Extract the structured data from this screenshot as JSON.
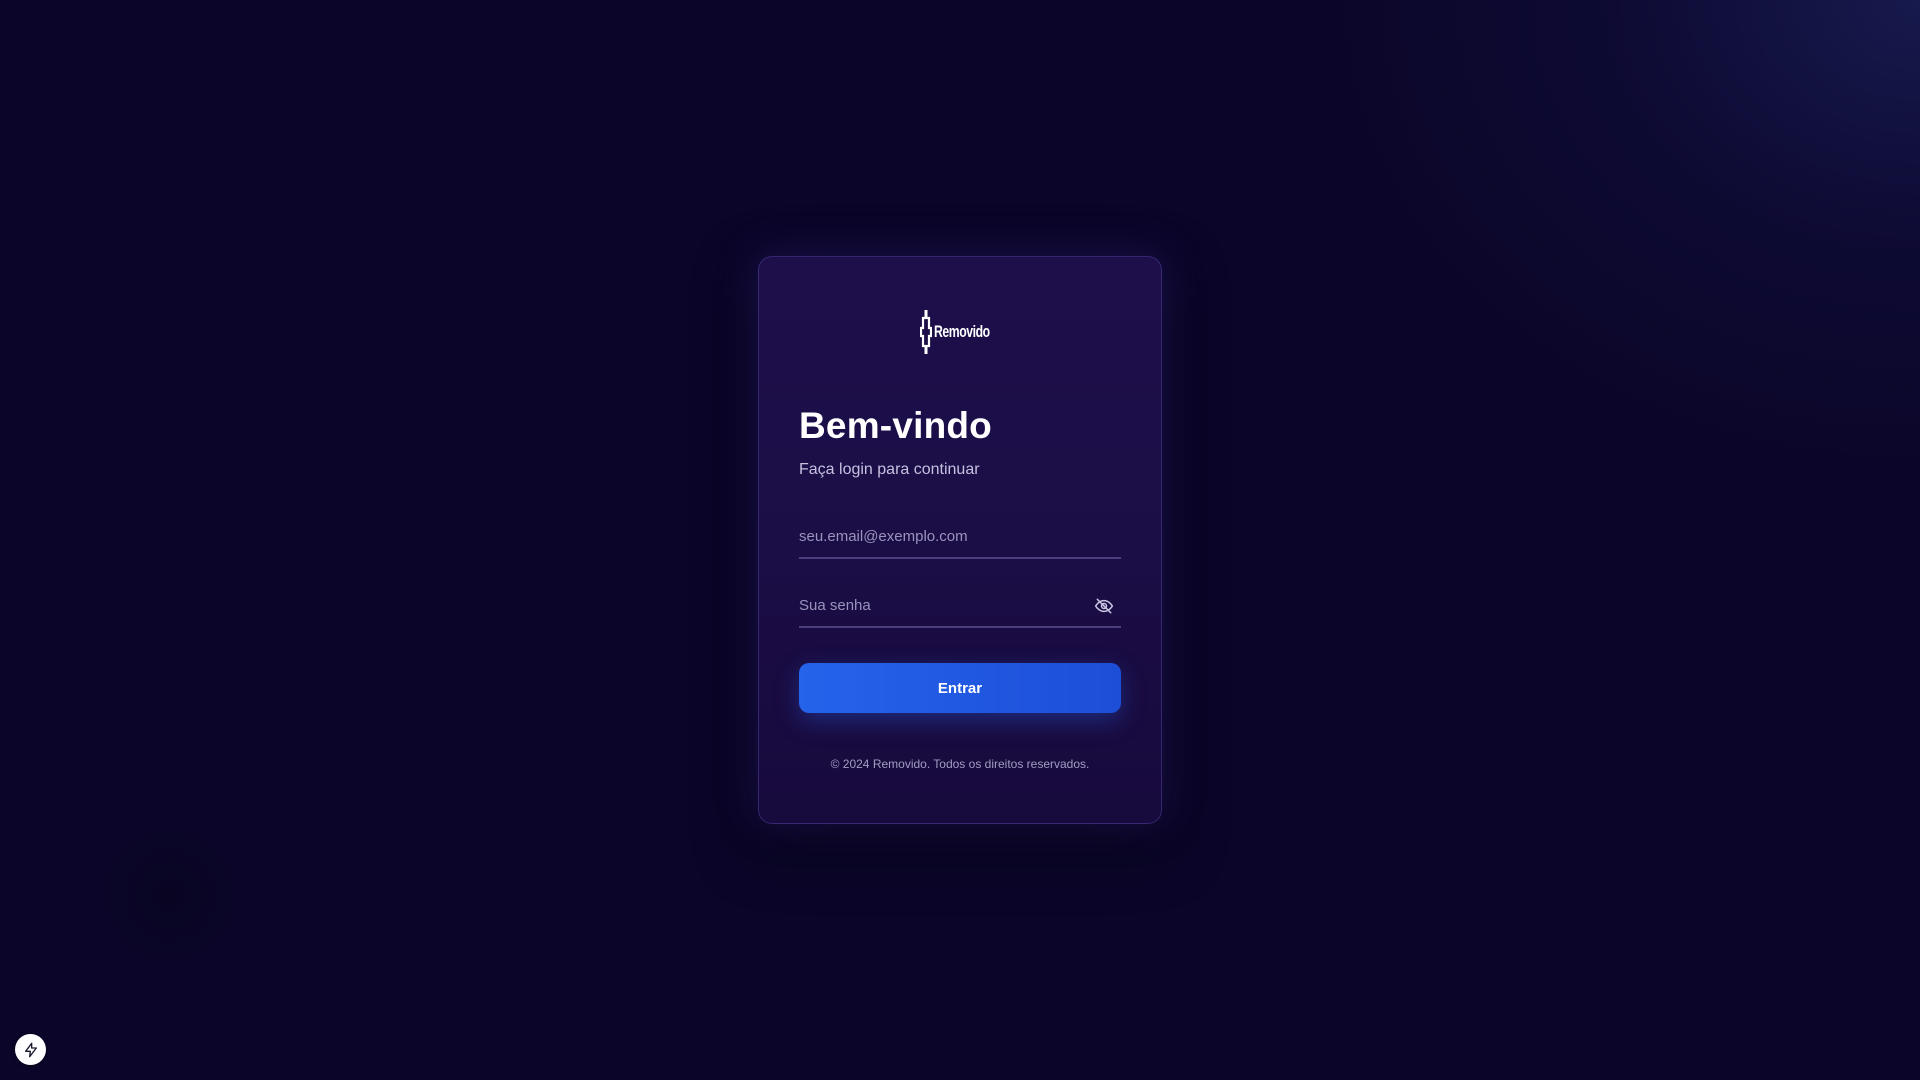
{
  "brand": {
    "logo_text": "Removido",
    "logo_icon": "bracket-logo-icon"
  },
  "login": {
    "title": "Bem-vindo",
    "subtitle": "Faça login para continuar",
    "email_placeholder": "seu.email@exemplo.com",
    "email_value": "",
    "password_placeholder": "Sua senha",
    "password_value": "",
    "password_toggle_icon": "eye-off-icon",
    "submit_label": "Entrar"
  },
  "footer": {
    "copyright": "© 2024 Removido. Todos os direitos reservados."
  },
  "corner_badge": {
    "icon": "lightning-icon"
  },
  "colors": {
    "background": "#0b0629",
    "card": "#1d0e48",
    "accent": "#2563eb",
    "input_border": "#4a3f7c"
  }
}
